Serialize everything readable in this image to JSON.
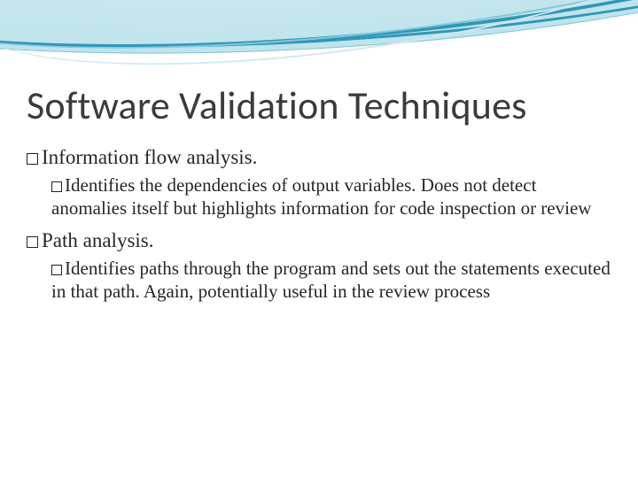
{
  "title": "Software Validation Techniques",
  "bullets": [
    {
      "text": "Information flow analysis.",
      "sub": [
        "Identifies the  dependencies of output variables. Does not  detect anomalies itself but highlights  information for code inspection or review"
      ]
    },
    {
      "text": "Path analysis.",
      "sub": [
        "Identifies paths through the program and sets out the statements executed in that path. Again, potentially useful in the review process"
      ]
    }
  ]
}
